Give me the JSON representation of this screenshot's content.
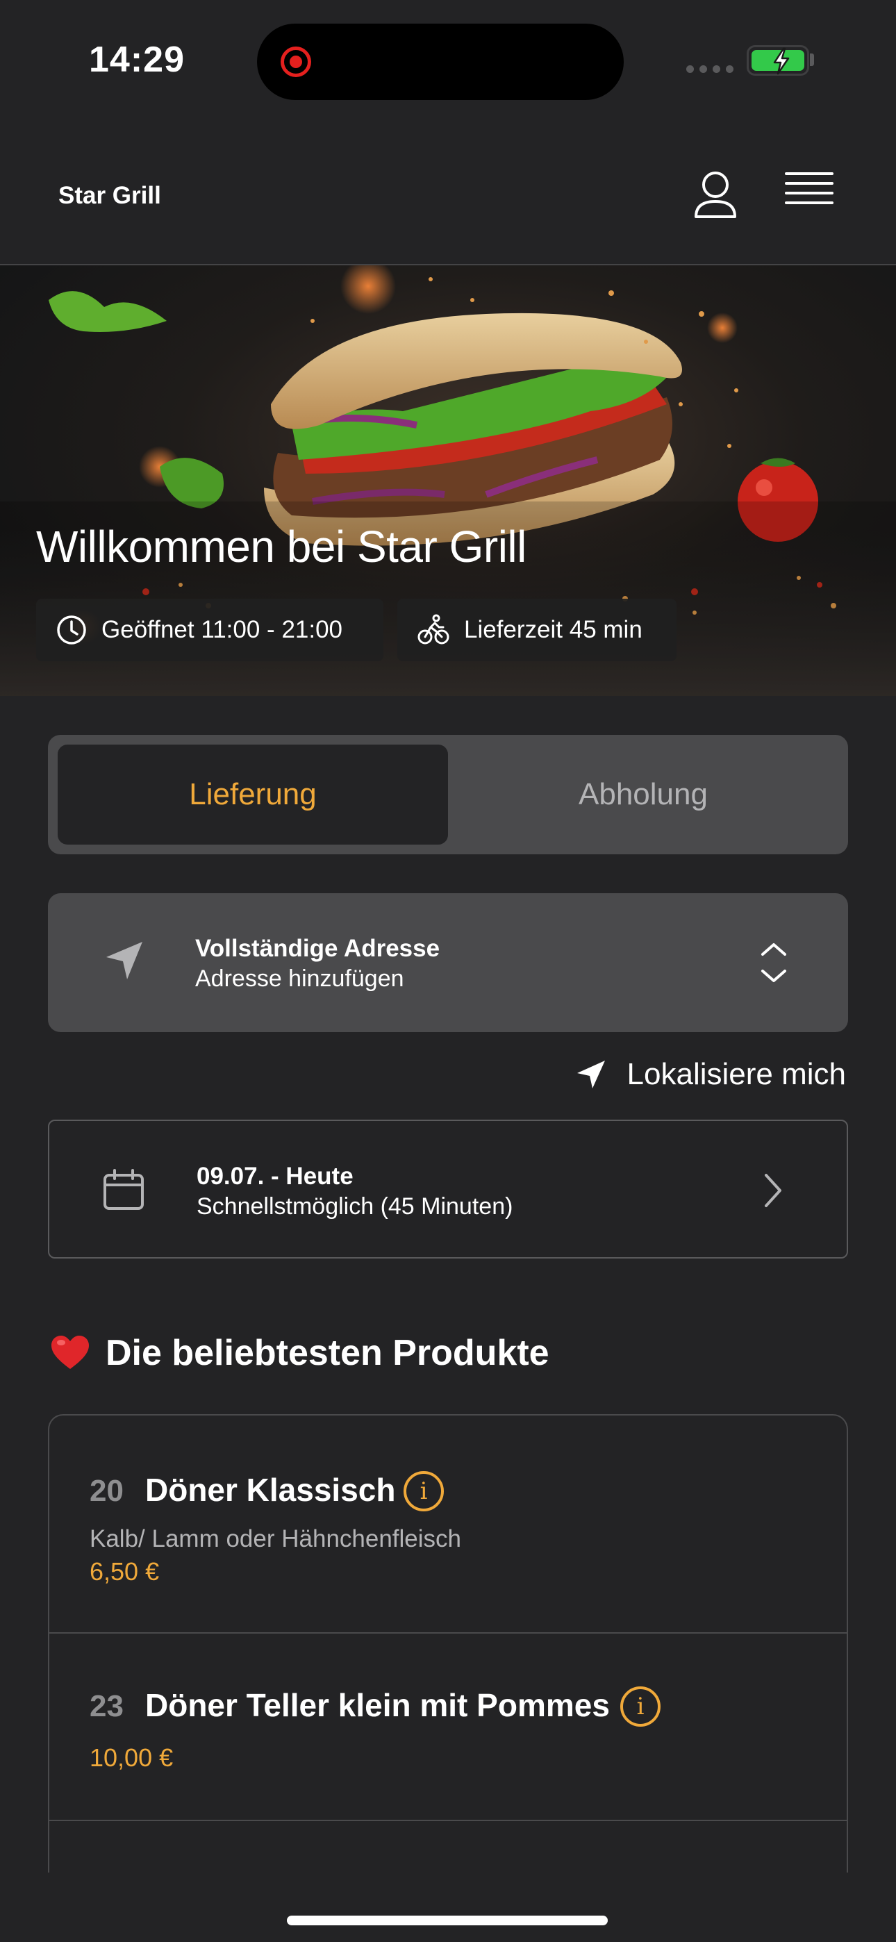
{
  "status_bar": {
    "time": "14:29"
  },
  "header": {
    "brand": "Star Grill"
  },
  "hero": {
    "title": "Willkommen bei Star Grill",
    "opening_hours": "Geöffnet 11:00 - 21:00",
    "delivery_time": "Lieferzeit 45 min"
  },
  "mode_toggle": {
    "options": [
      {
        "label": "Lieferung",
        "active": true
      },
      {
        "label": "Abholung",
        "active": false
      }
    ]
  },
  "address": {
    "title": "Vollständige Adresse",
    "subtitle": "Adresse hinzufügen"
  },
  "locate": {
    "label": "Lokalisiere mich"
  },
  "schedule": {
    "date": "09.07. - Heute",
    "time": "Schnellstmöglich (45 Minuten)"
  },
  "popular": {
    "heading": "Die beliebtesten Produkte",
    "products": [
      {
        "number": "20",
        "name": "Döner Klassisch",
        "description": "Kalb/ Lamm oder Hähnchenfleisch",
        "price": "6,50 €"
      },
      {
        "number": "23",
        "name": "Döner Teller klein mit Pommes",
        "price": "10,00 €"
      }
    ]
  },
  "colors": {
    "background": "#232325",
    "accent": "#f0a93a",
    "card": "#4a4a4c",
    "battery": "#33c94a",
    "recording": "#e5201e"
  },
  "icons": [
    "clock-icon",
    "bike-icon",
    "user-icon",
    "menu-icon",
    "navigation-arrow-icon",
    "stepper-icon",
    "calendar-icon",
    "chevron-right-icon",
    "heart-icon",
    "info-icon",
    "battery-icon"
  ]
}
